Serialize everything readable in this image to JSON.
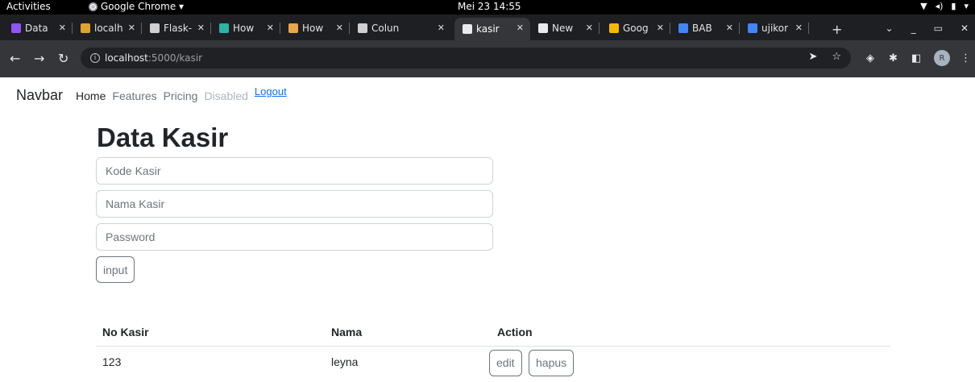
{
  "system_bar": {
    "activities": "Activities",
    "app_name": "Google Chrome ▾",
    "clock": "Mei 23  14:55",
    "tray_icons": [
      "wifi-icon",
      "volume-icon",
      "battery-icon",
      "menu-down-icon"
    ]
  },
  "tabs": [
    {
      "title": "Data",
      "favicon_color": "#8e56f5",
      "active": false
    },
    {
      "title": "localh",
      "favicon_color": "#e0a22e",
      "active": false
    },
    {
      "title": "Flask-",
      "favicon_color": "#cfcfcf",
      "active": false
    },
    {
      "title": "How",
      "favicon_color": "#2bb3a6",
      "active": false
    },
    {
      "title": "How",
      "favicon_color": "#e8a54a",
      "active": false
    },
    {
      "title": "Colun",
      "favicon_color": "#d0d0d0",
      "active": false
    },
    {
      "title": "kasir",
      "favicon_color": "#e8eaed",
      "active": true
    },
    {
      "title": "New",
      "favicon_color": "#e8eaed",
      "active": false
    },
    {
      "title": "Goog",
      "favicon_color": "#f6b900",
      "active": false
    },
    {
      "title": "BAB",
      "favicon_color": "#4285f4",
      "active": false
    },
    {
      "title": "ujikor",
      "favicon_color": "#4285f4",
      "active": false
    }
  ],
  "browser": {
    "url_host": "localhost",
    "url_path": ":5000/kasir",
    "profile_initial": "R"
  },
  "navbar": {
    "brand": "Navbar",
    "links": [
      "Home",
      "Features",
      "Pricing",
      "Disabled"
    ],
    "logout": "Logout"
  },
  "heading": "Data Kasir",
  "form": {
    "kode_placeholder": "Kode Kasir",
    "nama_placeholder": "Nama Kasir",
    "password_placeholder": "Password",
    "submit": "input"
  },
  "table": {
    "headers": [
      "No Kasir",
      "Nama",
      "Action"
    ],
    "rows": [
      {
        "no": "123",
        "nama": "leyna",
        "edit": "edit",
        "hapus": "hapus"
      }
    ]
  },
  "colors": {
    "link": "#0d6efd",
    "chrome_dark": "#35363a",
    "tabstrip": "#1d1f23"
  }
}
